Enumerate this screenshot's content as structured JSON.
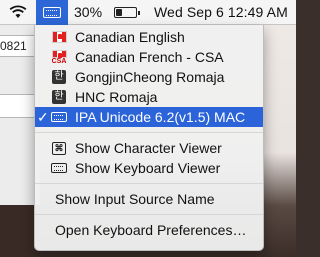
{
  "menubar": {
    "battery_percent": "30%",
    "battery_level": 0.3,
    "clock": "Wed Sep 6  12:49 AM"
  },
  "background": {
    "field_text": "0821"
  },
  "menu": {
    "items": [
      {
        "label": "Canadian English",
        "icon": "canada-flag-icon"
      },
      {
        "label": "Canadian French - CSA",
        "icon": "canada-flag-csa-icon",
        "badge": "CSA"
      },
      {
        "label": "GongjinCheong Romaja",
        "icon": "hangul-icon",
        "glyph": "한"
      },
      {
        "label": "HNC Romaja",
        "icon": "hangul-icon",
        "glyph": "한"
      },
      {
        "label": "IPA Unicode 6.2(v1.5) MAC",
        "icon": "keyboard-icon",
        "checked": true,
        "check": "✓"
      }
    ],
    "viewers": [
      {
        "label": "Show Character Viewer",
        "icon": "character-viewer-icon",
        "glyph": "⌘"
      },
      {
        "label": "Show Keyboard Viewer",
        "icon": "keyboard-viewer-icon"
      }
    ],
    "show_input_source_name": "Show Input Source Name",
    "open_prefs": "Open Keyboard Preferences…"
  },
  "colors": {
    "selection": "#2b63d8",
    "menubar_highlight": "#2d66d6"
  }
}
